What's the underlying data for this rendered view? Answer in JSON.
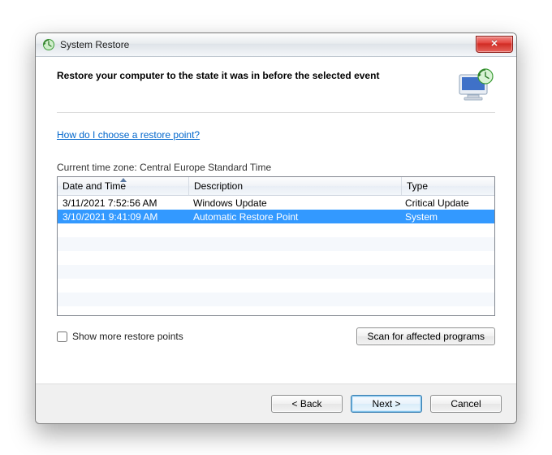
{
  "window_title": "System Restore",
  "heading": "Restore your computer to the state it was in before the selected event",
  "help_link": "How do I choose a restore point?",
  "time_zone_label": "Current time zone: Central Europe Standard Time",
  "columns": {
    "date_time": "Date and Time",
    "description": "Description",
    "type": "Type"
  },
  "rows": [
    {
      "date": "3/11/2021 7:52:56 AM",
      "desc": "Windows Update",
      "type": "Critical Update",
      "selected": false
    },
    {
      "date": "3/10/2021 9:41:09 AM",
      "desc": "Automatic Restore Point",
      "type": "System",
      "selected": true
    }
  ],
  "show_more_label": "Show more restore points",
  "scan_button": "Scan for affected programs",
  "buttons": {
    "back": "< Back",
    "next": "Next >",
    "cancel": "Cancel"
  },
  "close_glyph": "✕"
}
